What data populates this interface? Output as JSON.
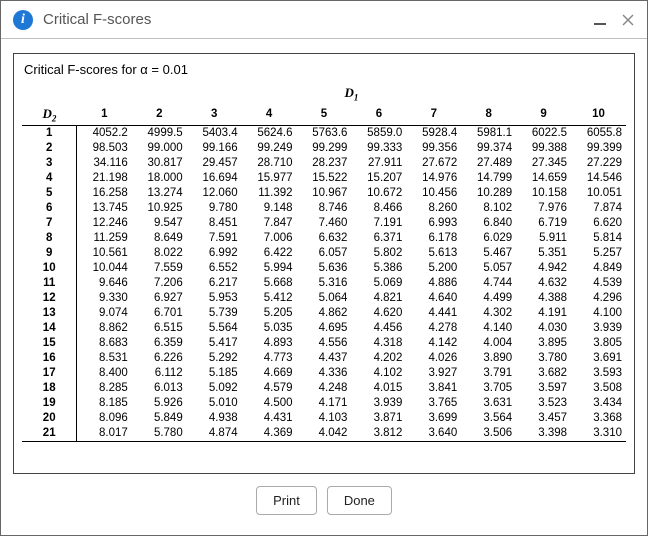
{
  "window": {
    "title": "Critical F-scores"
  },
  "panel": {
    "title": "Critical F-scores for α = 0.01",
    "d1_label": "D",
    "d1_sub": "1",
    "d2_label": "D",
    "d2_sub": "2"
  },
  "footer": {
    "print": "Print",
    "done": "Done"
  },
  "chart_data": {
    "type": "table",
    "title": "Critical F-scores for α = 0.01",
    "col_label": "D1",
    "row_label": "D2",
    "columns": [
      "1",
      "2",
      "3",
      "4",
      "5",
      "6",
      "7",
      "8",
      "9",
      "10"
    ],
    "rows": [
      {
        "d2": "1",
        "v": [
          "4052.2",
          "4999.5",
          "5403.4",
          "5624.6",
          "5763.6",
          "5859.0",
          "5928.4",
          "5981.1",
          "6022.5",
          "6055.8"
        ]
      },
      {
        "d2": "2",
        "v": [
          "98.503",
          "99.000",
          "99.166",
          "99.249",
          "99.299",
          "99.333",
          "99.356",
          "99.374",
          "99.388",
          "99.399"
        ]
      },
      {
        "d2": "3",
        "v": [
          "34.116",
          "30.817",
          "29.457",
          "28.710",
          "28.237",
          "27.911",
          "27.672",
          "27.489",
          "27.345",
          "27.229"
        ]
      },
      {
        "d2": "4",
        "v": [
          "21.198",
          "18.000",
          "16.694",
          "15.977",
          "15.522",
          "15.207",
          "14.976",
          "14.799",
          "14.659",
          "14.546"
        ]
      },
      {
        "d2": "5",
        "v": [
          "16.258",
          "13.274",
          "12.060",
          "11.392",
          "10.967",
          "10.672",
          "10.456",
          "10.289",
          "10.158",
          "10.051"
        ]
      },
      {
        "d2": "6",
        "v": [
          "13.745",
          "10.925",
          "9.780",
          "9.148",
          "8.746",
          "8.466",
          "8.260",
          "8.102",
          "7.976",
          "7.874"
        ]
      },
      {
        "d2": "7",
        "v": [
          "12.246",
          "9.547",
          "8.451",
          "7.847",
          "7.460",
          "7.191",
          "6.993",
          "6.840",
          "6.719",
          "6.620"
        ]
      },
      {
        "d2": "8",
        "v": [
          "11.259",
          "8.649",
          "7.591",
          "7.006",
          "6.632",
          "6.371",
          "6.178",
          "6.029",
          "5.911",
          "5.814"
        ]
      },
      {
        "d2": "9",
        "v": [
          "10.561",
          "8.022",
          "6.992",
          "6.422",
          "6.057",
          "5.802",
          "5.613",
          "5.467",
          "5.351",
          "5.257"
        ]
      },
      {
        "d2": "10",
        "v": [
          "10.044",
          "7.559",
          "6.552",
          "5.994",
          "5.636",
          "5.386",
          "5.200",
          "5.057",
          "4.942",
          "4.849"
        ]
      },
      {
        "d2": "11",
        "v": [
          "9.646",
          "7.206",
          "6.217",
          "5.668",
          "5.316",
          "5.069",
          "4.886",
          "4.744",
          "4.632",
          "4.539"
        ]
      },
      {
        "d2": "12",
        "v": [
          "9.330",
          "6.927",
          "5.953",
          "5.412",
          "5.064",
          "4.821",
          "4.640",
          "4.499",
          "4.388",
          "4.296"
        ]
      },
      {
        "d2": "13",
        "v": [
          "9.074",
          "6.701",
          "5.739",
          "5.205",
          "4.862",
          "4.620",
          "4.441",
          "4.302",
          "4.191",
          "4.100"
        ]
      },
      {
        "d2": "14",
        "v": [
          "8.862",
          "6.515",
          "5.564",
          "5.035",
          "4.695",
          "4.456",
          "4.278",
          "4.140",
          "4.030",
          "3.939"
        ]
      },
      {
        "d2": "15",
        "v": [
          "8.683",
          "6.359",
          "5.417",
          "4.893",
          "4.556",
          "4.318",
          "4.142",
          "4.004",
          "3.895",
          "3.805"
        ]
      },
      {
        "d2": "16",
        "v": [
          "8.531",
          "6.226",
          "5.292",
          "4.773",
          "4.437",
          "4.202",
          "4.026",
          "3.890",
          "3.780",
          "3.691"
        ]
      },
      {
        "d2": "17",
        "v": [
          "8.400",
          "6.112",
          "5.185",
          "4.669",
          "4.336",
          "4.102",
          "3.927",
          "3.791",
          "3.682",
          "3.593"
        ]
      },
      {
        "d2": "18",
        "v": [
          "8.285",
          "6.013",
          "5.092",
          "4.579",
          "4.248",
          "4.015",
          "3.841",
          "3.705",
          "3.597",
          "3.508"
        ]
      },
      {
        "d2": "19",
        "v": [
          "8.185",
          "5.926",
          "5.010",
          "4.500",
          "4.171",
          "3.939",
          "3.765",
          "3.631",
          "3.523",
          "3.434"
        ]
      },
      {
        "d2": "20",
        "v": [
          "8.096",
          "5.849",
          "4.938",
          "4.431",
          "4.103",
          "3.871",
          "3.699",
          "3.564",
          "3.457",
          "3.368"
        ]
      },
      {
        "d2": "21",
        "v": [
          "8.017",
          "5.780",
          "4.874",
          "4.369",
          "4.042",
          "3.812",
          "3.640",
          "3.506",
          "3.398",
          "3.310"
        ]
      }
    ]
  }
}
